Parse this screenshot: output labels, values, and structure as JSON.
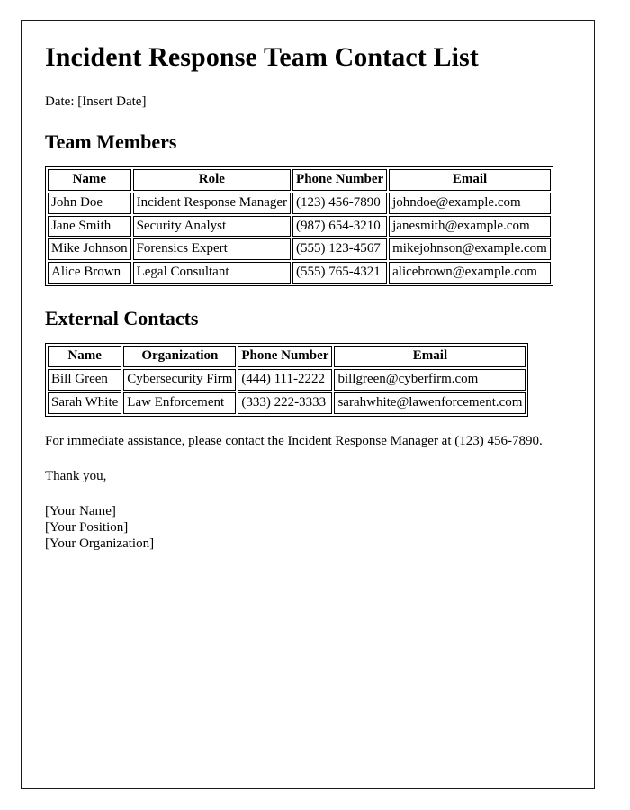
{
  "document": {
    "title": "Incident Response Team Contact List",
    "date_line": "Date: [Insert Date]",
    "sections": {
      "team_members_heading": "Team Members",
      "external_contacts_heading": "External Contacts"
    },
    "team_members_table": {
      "headers": [
        "Name",
        "Role",
        "Phone Number",
        "Email"
      ],
      "rows": [
        [
          "John Doe",
          "Incident Response Manager",
          "(123) 456-7890",
          "johndoe@example.com"
        ],
        [
          "Jane Smith",
          "Security Analyst",
          "(987) 654-3210",
          "janesmith@example.com"
        ],
        [
          "Mike Johnson",
          "Forensics Expert",
          "(555) 123-4567",
          "mikejohnson@example.com"
        ],
        [
          "Alice Brown",
          "Legal Consultant",
          "(555) 765-4321",
          "alicebrown@example.com"
        ]
      ]
    },
    "external_contacts_table": {
      "headers": [
        "Name",
        "Organization",
        "Phone Number",
        "Email"
      ],
      "rows": [
        [
          "Bill Green",
          "Cybersecurity Firm",
          "(444) 111-2222",
          "billgreen@cyberfirm.com"
        ],
        [
          "Sarah White",
          "Law Enforcement",
          "(333) 222-3333",
          "sarahwhite@lawenforcement.com"
        ]
      ]
    },
    "closing": {
      "assistance_text": "For immediate assistance, please contact the Incident Response Manager at (123) 456-7890.",
      "thanks": "Thank you,",
      "signature": [
        "[Your Name]",
        "[Your Position]",
        "[Your Organization]"
      ]
    }
  },
  "colors": {
    "text": "#000000",
    "page_border": "#1a1a1a",
    "table_border": "#000000",
    "background": "#ffffff"
  }
}
